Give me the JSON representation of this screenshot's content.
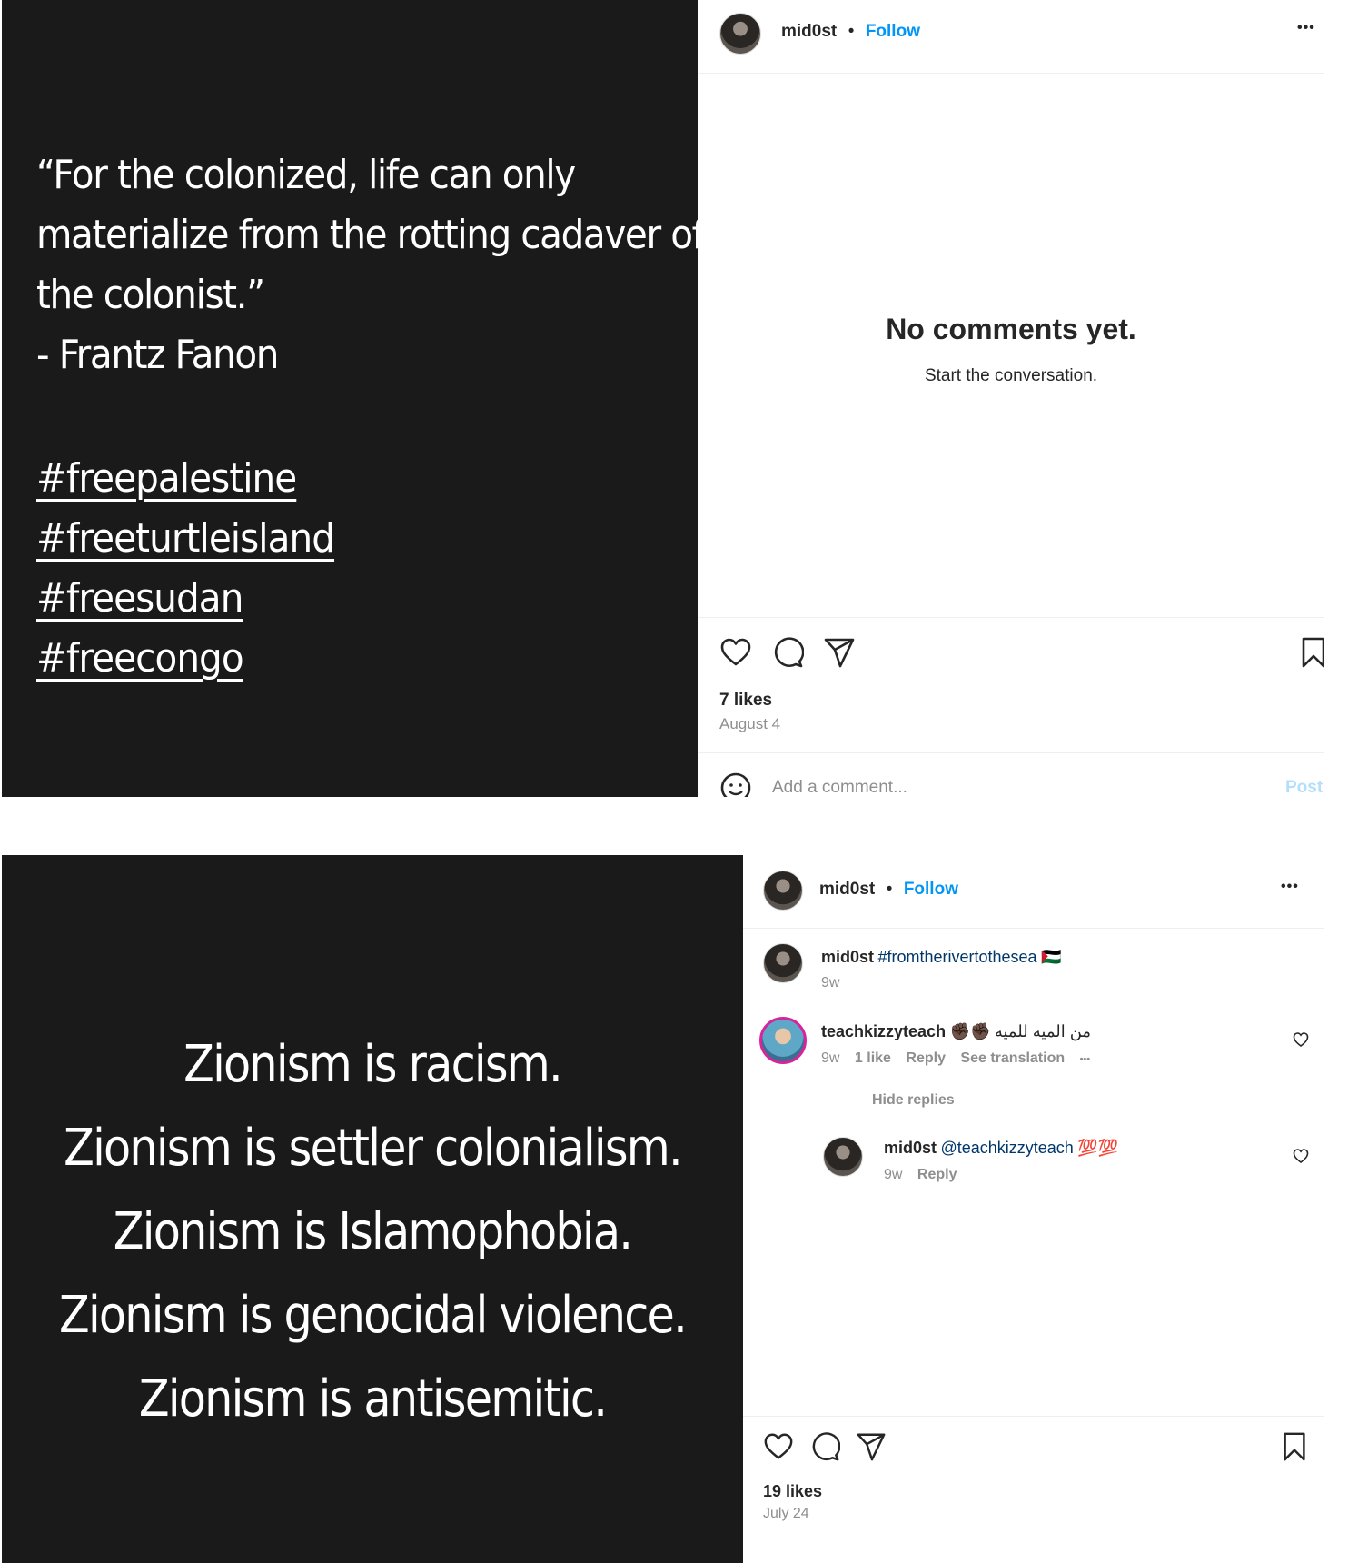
{
  "post1": {
    "quote_lines": [
      "“For the colonized, life can only",
      "materialize from the rotting cadaver of",
      "the colonist.”",
      "- Frantz Fanon"
    ],
    "hashtags": [
      "#freepalestine",
      "#freeturtleisland",
      "#freesudan",
      "#freecongo"
    ],
    "username": "mid0st",
    "separator": "•",
    "follow_label": "Follow",
    "more_label": "•••",
    "empty_title": "No comments yet.",
    "empty_subtitle": "Start the conversation.",
    "likes": "7 likes",
    "date": "August 4",
    "comment_placeholder": "Add a comment...",
    "post_label": "Post"
  },
  "post2": {
    "lines": [
      "Zionism is racism.",
      "Zionism is settler colonialism.",
      "Zionism is Islamophobia.",
      "Zionism is genocidal violence.",
      "Zionism is antisemitic."
    ],
    "username": "mid0st",
    "separator": "•",
    "follow_label": "Follow",
    "more_label": "•••",
    "caption": {
      "username": "mid0st",
      "hashtag": "#fromtherivertothesea",
      "flag": "🇵🇸",
      "time": "9w"
    },
    "comment": {
      "username": "teachkizzyteach",
      "emoji": "✊🏿✊🏿",
      "text": "من الميه للميه",
      "time": "9w",
      "likes": "1 like",
      "reply": "Reply",
      "see_translation": "See translation",
      "more": "•••"
    },
    "hide_replies": "Hide replies",
    "reply": {
      "username": "mid0st",
      "mention": "@teachkizzyteach",
      "emoji": "💯💯",
      "time": "9w",
      "reply": "Reply"
    },
    "likes": "19 likes",
    "date": "July 24"
  },
  "icons": [
    "heart-icon",
    "comment-icon",
    "share-icon",
    "bookmark-icon",
    "emoji-icon",
    "more-icon"
  ]
}
